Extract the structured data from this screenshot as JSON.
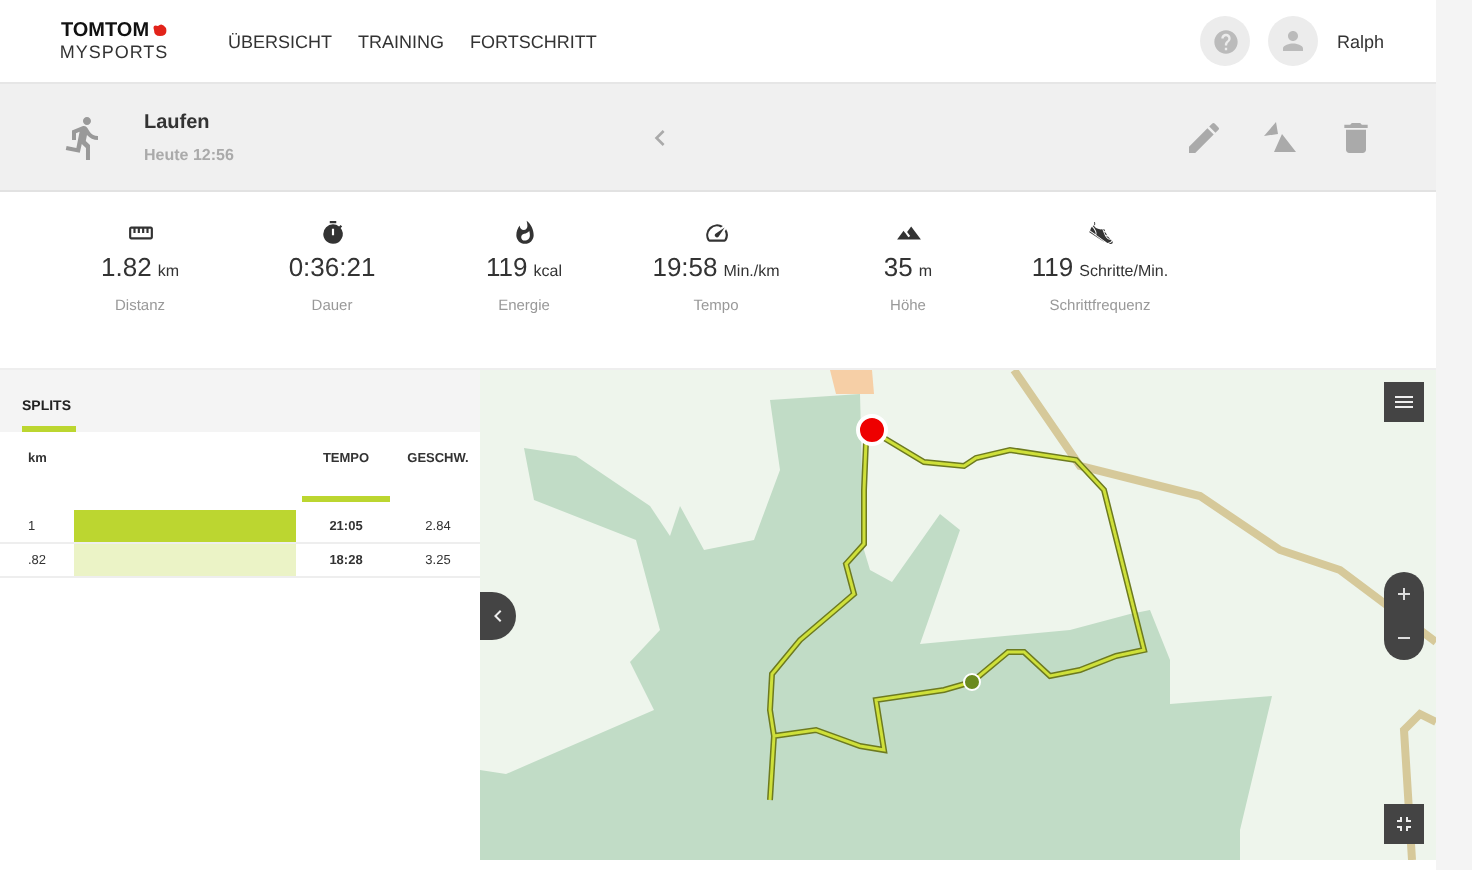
{
  "header": {
    "logo": {
      "brand": "TOMTOM",
      "product": "MYSPORTS"
    },
    "nav": [
      {
        "label": "ÜBERSICHT",
        "selected": false
      },
      {
        "label": "TRAINING",
        "selected": false
      },
      {
        "label": "FORTSCHRITT",
        "selected": false
      }
    ],
    "user": {
      "name": "Ralph"
    }
  },
  "activity": {
    "title": "Laufen",
    "time": "Heute 12:56"
  },
  "stats": [
    {
      "kind": "distance",
      "value": "1.82",
      "unit": "km",
      "label": "Distanz"
    },
    {
      "kind": "duration",
      "value": "0:36:21",
      "label": "Dauer"
    },
    {
      "kind": "energy",
      "value": "119",
      "unit": "kcal",
      "label": "Energie"
    },
    {
      "kind": "pace",
      "value": "19:58",
      "unit": "Min./km",
      "label": "Tempo"
    },
    {
      "kind": "elevation",
      "value": "35",
      "unit": "m",
      "label": "Höhe"
    },
    {
      "kind": "cadence",
      "value": "119",
      "unit": "Schritte/Min.",
      "label": "Schrittfrequenz"
    }
  ],
  "splits": {
    "tabs": [
      {
        "label": "SPLITS",
        "selected": true
      }
    ],
    "columns": [
      {
        "label": "km",
        "highlighted": false
      },
      {
        "label": "TEMPO",
        "highlighted": true
      },
      {
        "label": "GESCHW.",
        "highlighted": false
      }
    ],
    "rows": [
      {
        "km": "1",
        "tempo": "21:05",
        "speed": "2.84",
        "selected": true
      },
      {
        "km": ".82",
        "tempo": "18:28",
        "speed": "3.25",
        "selected": false
      }
    ]
  }
}
